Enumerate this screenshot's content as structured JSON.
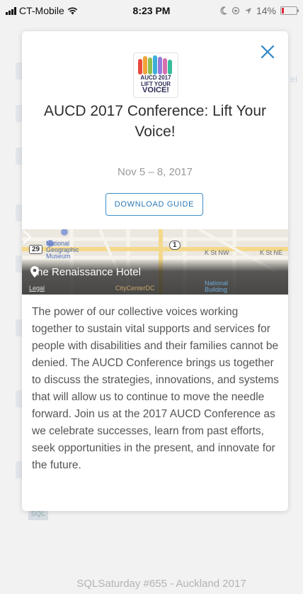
{
  "status_bar": {
    "carrier": "CT-Mobile",
    "time": "8:23 PM",
    "battery": "14%"
  },
  "background_list": {
    "bottom_item_title": "SQLSaturday #655 - Auckland 2017",
    "bottom_item_tile_text": "SQL",
    "right_edge_text": "el"
  },
  "event": {
    "logo_line1": "AUCD 2017",
    "logo_line2": "LIFT YOUR",
    "logo_line3": "VOICE!",
    "title": "AUCD 2017 Conference: Lift Your Voice!",
    "date": "Nov 5 – 8, 2017",
    "download_label": "DOWNLOAD GUIDE",
    "venue": "The Renaissance Hotel",
    "map_labels": {
      "national_geographic": "National Geographic Museum",
      "route": "29",
      "route2": "1",
      "k_st_nw": "K St NW",
      "k_st_ne": "K St NE",
      "legal": "Legal",
      "citycenter": "CityCenterDC",
      "national_building": "National Building"
    },
    "description": "The power of our collective voices working together to sustain vital supports and services for people with disabilities and their families cannot be denied. The AUCD Conference brings us together to discuss the strategies, innovations, and systems that will allow us to continue to move the needle forward. Join us at the 2017 AUCD Conference as we celebrate successes, learn from past efforts, seek opportunities in the present, and innovate for the future."
  },
  "colors": {
    "accent": "#2b79b5",
    "battery_low": "#e0263a"
  }
}
